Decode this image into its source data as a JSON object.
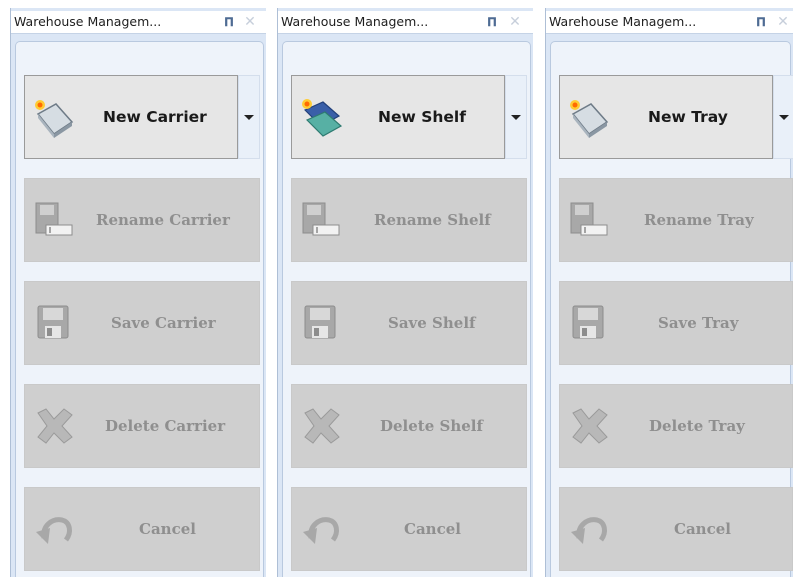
{
  "panels": [
    {
      "title": "Warehouse Managem...",
      "pin_glyph": "$",
      "new_label": "New Carrier",
      "rename_label": "Rename Carrier",
      "save_label": "Save Carrier",
      "delete_label": "Delete Carrier",
      "cancel_label": "Cancel"
    },
    {
      "title": "Warehouse Managem...",
      "new_label": "New Shelf",
      "rename_label": "Rename Shelf",
      "save_label": "Save Shelf",
      "delete_label": "Delete Shelf",
      "cancel_label": "Cancel"
    },
    {
      "title": "Warehouse Managem...",
      "new_label": "New Tray",
      "rename_label": "Rename Tray",
      "save_label": "Save Tray",
      "delete_label": "Delete Tray",
      "cancel_label": "Cancel"
    }
  ],
  "icons": {
    "pin": "pin-icon",
    "close": "close-icon",
    "new": "new-item-icon",
    "rename": "rename-icon",
    "save": "save-disk-icon",
    "delete": "delete-x-icon",
    "cancel": "undo-arrow-icon",
    "dropdown": "chevron-down-icon"
  },
  "colors": {
    "panel_bg": "#dbe6f5",
    "inner_bg": "#eef3fa",
    "disabled_button": "#cfcfcf",
    "disabled_text": "#8f8f8f",
    "primary_button": "#e6e6e6"
  }
}
